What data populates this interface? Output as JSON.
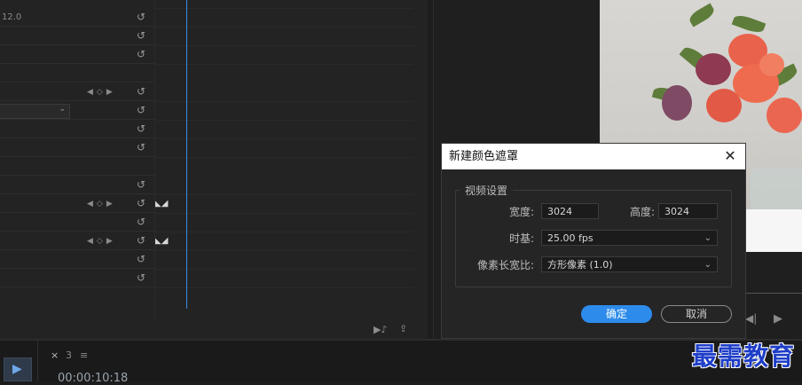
{
  "effect_controls": {
    "partial_value": "12.0",
    "reset_icon": "reset-icon",
    "keyframe_icon": "keyframe-nav-icon",
    "dropdown_arrow": "chevron-down-icon"
  },
  "timeline": {
    "tab_close": "×",
    "tab_number": "3",
    "tab_menu": "≡",
    "timecode": "00:00:10:18"
  },
  "dialog": {
    "title": "新建颜色遮罩",
    "close": "✕",
    "group_label": "视频设置",
    "width_label": "宽度:",
    "width_value": "3024",
    "height_label": "高度:",
    "height_value": "3024",
    "timebase_label": "时基:",
    "timebase_value": "25.00 fps",
    "pixel_aspect_label": "像素长宽比:",
    "pixel_aspect_value": "方形像素 (1.0)",
    "ok_label": "确定",
    "cancel_label": "取消"
  },
  "watermark": "最需教育",
  "colors": {
    "accent": "#2d8ceb",
    "playhead": "#3a8ee6",
    "watermark": "#1e3ec8"
  }
}
